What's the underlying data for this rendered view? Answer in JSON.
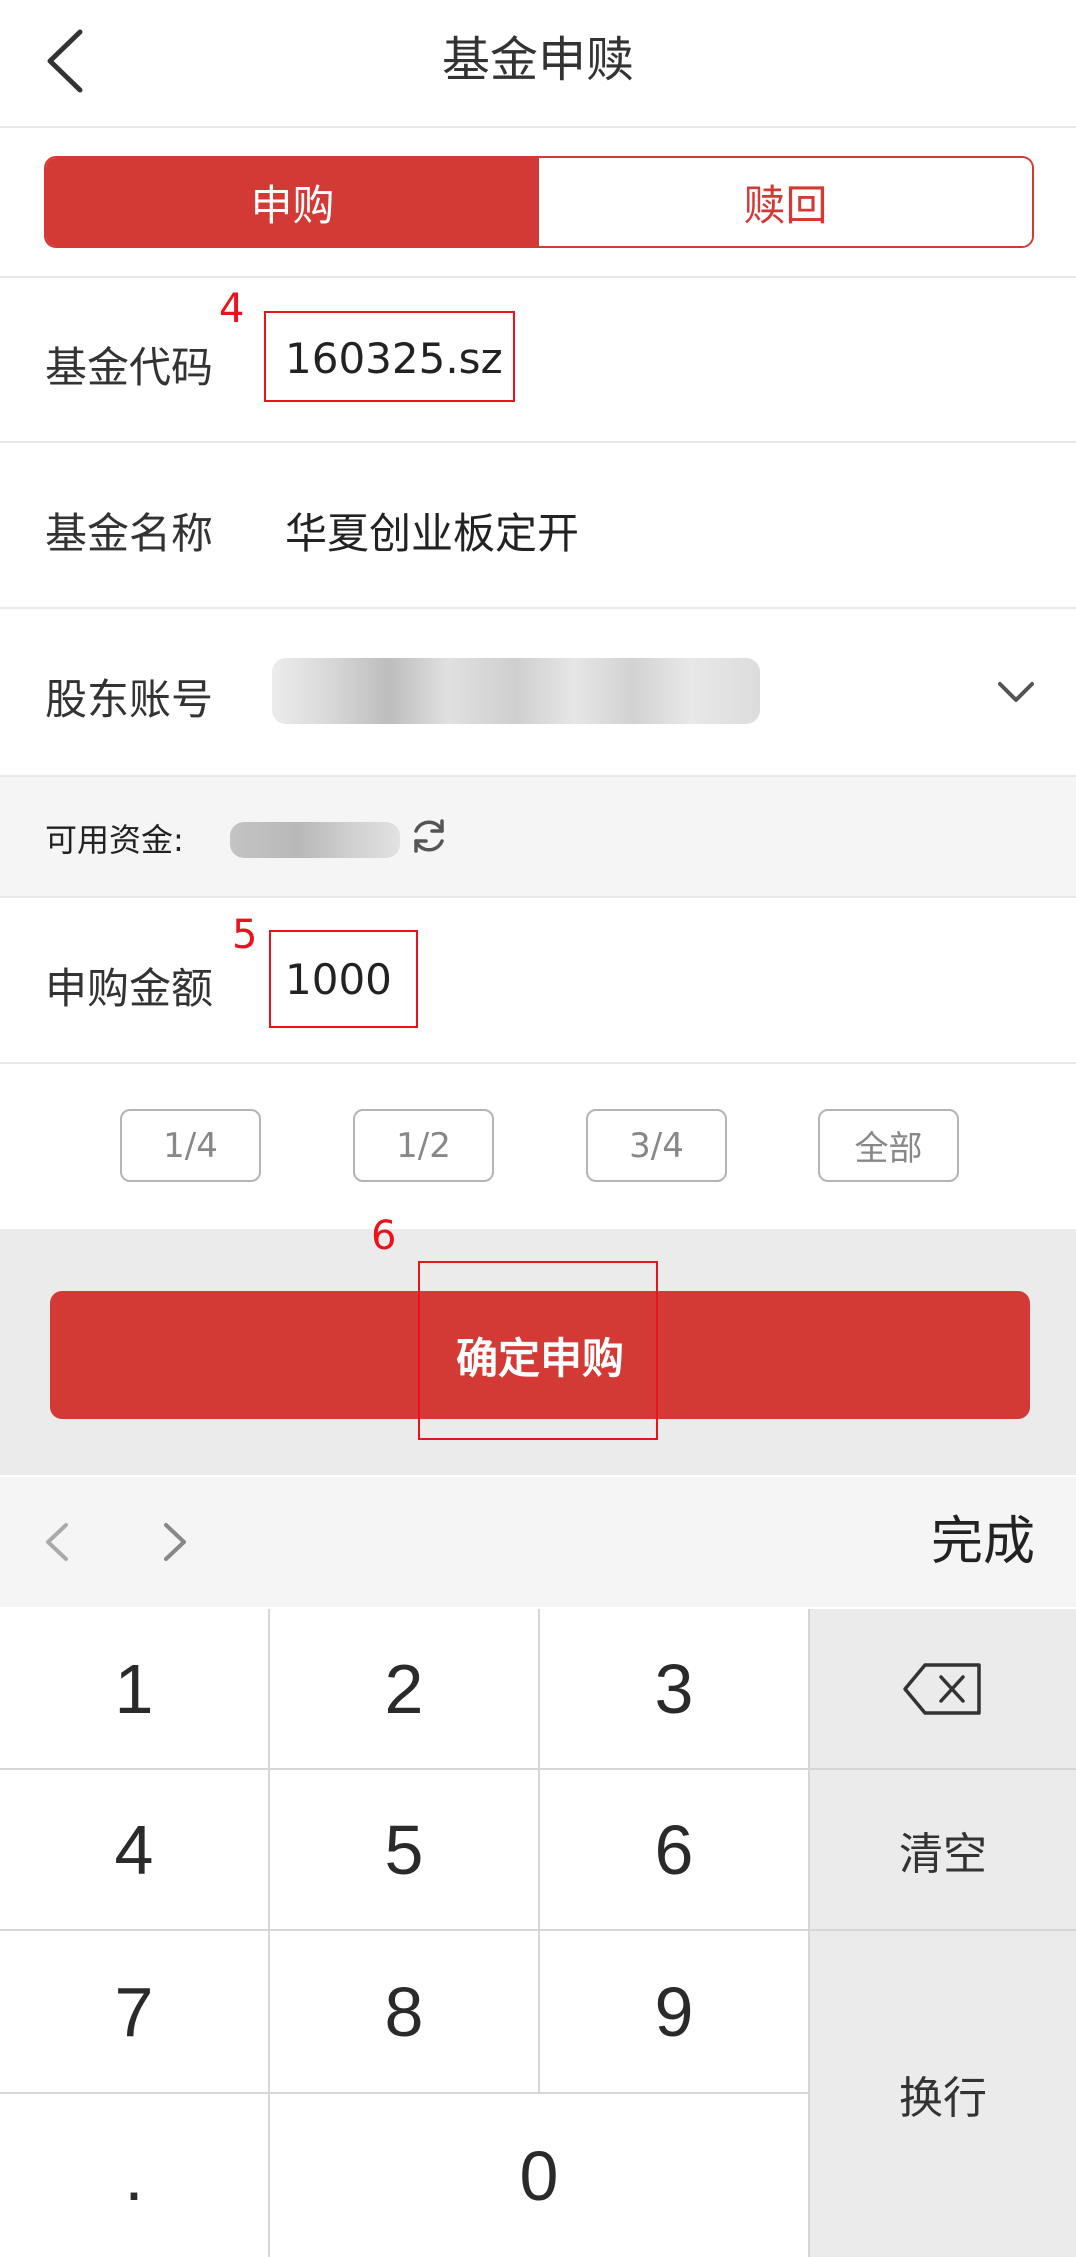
{
  "header": {
    "title": "基金申赎",
    "back_icon": "chevron-left-icon"
  },
  "tabs": [
    {
      "label": "申购",
      "active": true
    },
    {
      "label": "赎回",
      "active": false
    }
  ],
  "form": {
    "fund_code": {
      "label": "基金代码",
      "value": "160325.sz"
    },
    "fund_name": {
      "label": "基金名称",
      "value": "华夏创业板定开"
    },
    "account": {
      "label": "股东账号",
      "value_redacted": true,
      "dropdown_icon": "chevron-down-icon"
    },
    "funds": {
      "label": "可用资金:",
      "value_redacted": true,
      "refresh_icon": "refresh-icon"
    },
    "amount": {
      "label": "申购金额",
      "value": "1000"
    }
  },
  "quick_buttons": [
    "1/4",
    "1/2",
    "3/4",
    "全部"
  ],
  "confirm_label": "确定申购",
  "annotations": [
    "4",
    "5",
    "6"
  ],
  "keyboard": {
    "done_label": "完成",
    "digits": [
      "1",
      "2",
      "3",
      "4",
      "5",
      "6",
      "7",
      "8",
      "9",
      ".",
      "0"
    ],
    "clear_label": "清空",
    "newline_label": "换行",
    "backspace_icon": "backspace-icon",
    "prev_icon": "chevron-left-icon",
    "next_icon": "chevron-right-icon"
  },
  "colors": {
    "accent": "#d33a36",
    "annotation": "#e8131b"
  }
}
